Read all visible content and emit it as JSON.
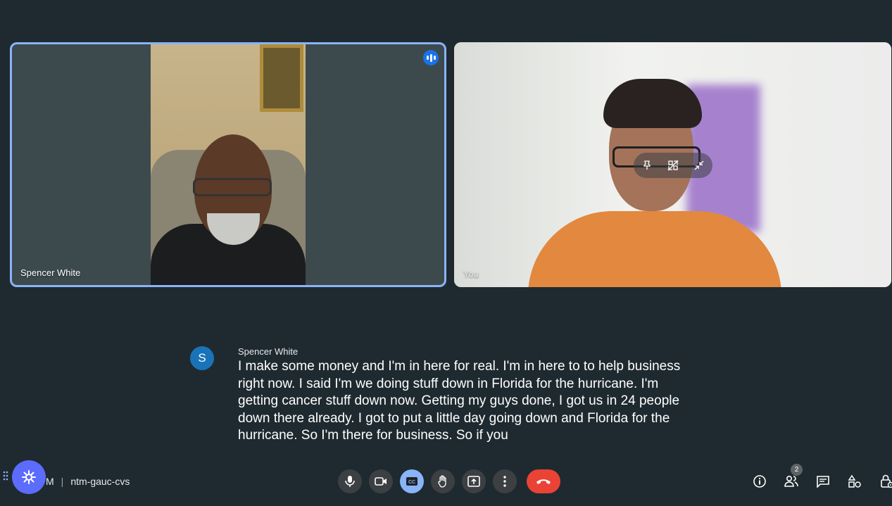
{
  "participants": {
    "left": {
      "name": "Spencer White",
      "is_speaking": true
    },
    "right": {
      "name": "You"
    }
  },
  "caption": {
    "avatar_letter": "S",
    "speaker": "Spencer White",
    "text": "I make some money and I'm in here for real. I'm in here to to help business right now. I said I'm we doing stuff down in Florida for the hurricane. I'm getting cancer stuff down now. Getting my guys done, I got us in 24 people down there already. I got to put a little day going down and Florida for the hurricane. So I'm there for business. So if you"
  },
  "meeting": {
    "initial": "M",
    "separator": "|",
    "code": "ntm-gauc-cvs"
  },
  "people_count": "2",
  "icons": {
    "tile_controls": [
      "pin-icon",
      "frame-icon",
      "minimize-icon"
    ],
    "toolbar": [
      "mic-icon",
      "camera-icon",
      "captions-icon",
      "raise-hand-icon",
      "present-icon",
      "more-options-icon",
      "end-call-icon"
    ],
    "right": [
      "info-icon",
      "people-icon",
      "chat-icon",
      "activities-icon",
      "host-controls-icon"
    ]
  },
  "colors": {
    "active_speaker_border": "#8ab4f8",
    "end_call": "#ea4335",
    "captions_active": "#8ab4f8"
  }
}
